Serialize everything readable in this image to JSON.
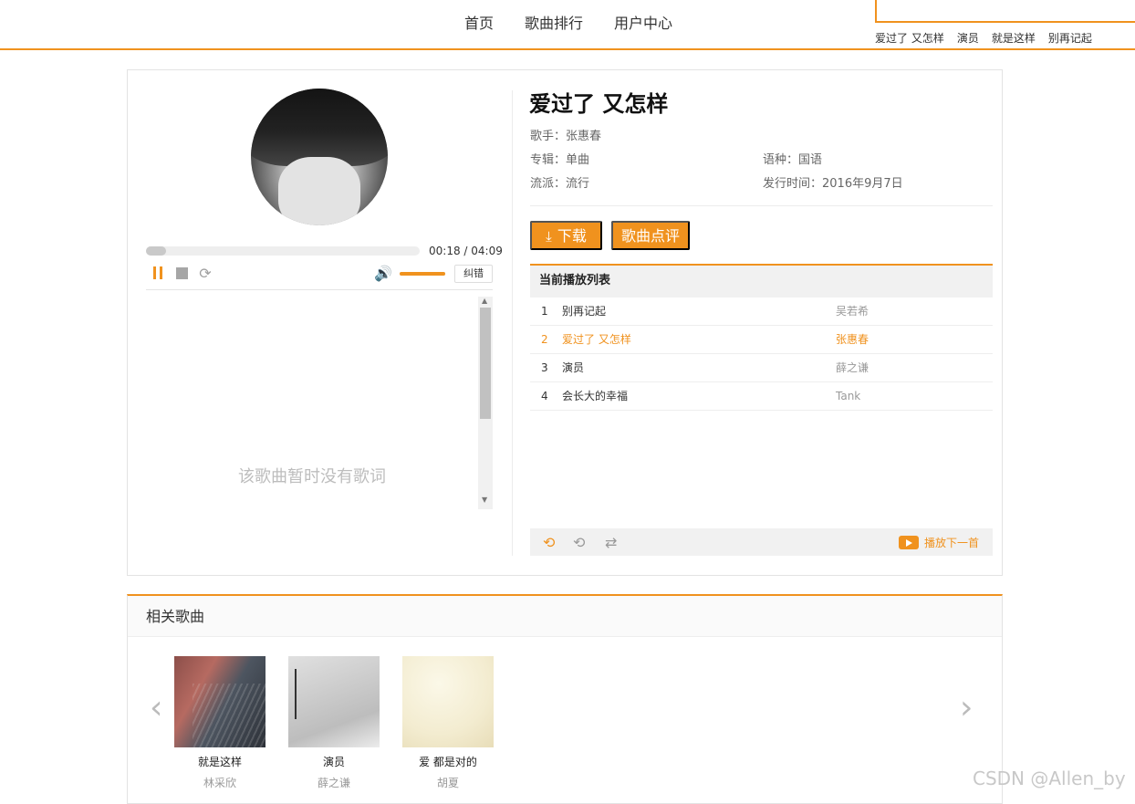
{
  "header": {
    "nav": [
      "首页",
      "歌曲排行",
      "用户中心"
    ],
    "hotwords": [
      "爱过了 又怎样",
      "演员",
      "就是这样",
      "别再记起"
    ]
  },
  "player": {
    "time": "00:18 / 04:09",
    "progress": 0.072,
    "volume": 1.0,
    "report_label": "纠错",
    "lyric_empty": "该歌曲暂时没有歌词"
  },
  "song": {
    "title": "爱过了 又怎样",
    "artist_label": "歌手：张惠春",
    "album_label": "专辑：单曲",
    "language_label": "语种：国语",
    "genre_label": "流派：流行",
    "release_label": "发行时间：2016年9月7日"
  },
  "buttons": {
    "download": "下载",
    "comment": "歌曲点评"
  },
  "playlist": {
    "title": "当前播放列表",
    "items": [
      {
        "num": "1",
        "name": "别再记起",
        "artist": "吴若希",
        "active": false
      },
      {
        "num": "2",
        "name": "爱过了 又怎样",
        "artist": "张惠春",
        "active": true
      },
      {
        "num": "3",
        "name": "演员",
        "artist": "薛之谦",
        "active": false
      },
      {
        "num": "4",
        "name": "会长大的幸福",
        "artist": "Tank",
        "active": false
      }
    ],
    "play_next": "播放下一首"
  },
  "related": {
    "title": "相关歌曲",
    "items": [
      {
        "name": "就是这样",
        "artist": "林采欣"
      },
      {
        "name": "演员",
        "artist": "薛之谦"
      },
      {
        "name": "爱 都是对的",
        "artist": "胡夏"
      }
    ]
  },
  "watermark": "CSDN @Allen_by",
  "colors": {
    "accent": "#f0921e"
  }
}
